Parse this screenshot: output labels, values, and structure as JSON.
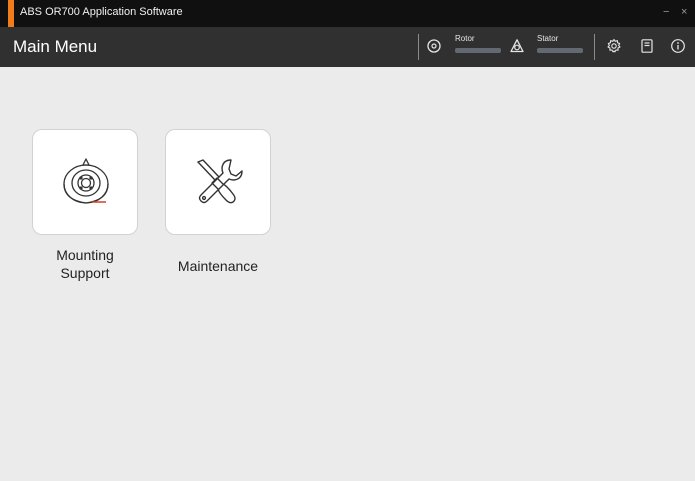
{
  "window": {
    "title": "ABS OR700 Application Software",
    "minimize_glyph": "−",
    "close_glyph": "×"
  },
  "header": {
    "page_title": "Main Menu",
    "rotor": {
      "label": "Rotor",
      "icon": "rotor-icon"
    },
    "stator": {
      "label": "Stator",
      "icon": "stator-icon"
    },
    "settings_icon": "gear-icon",
    "manual_icon": "document-icon",
    "info_icon": "info-icon"
  },
  "menu": {
    "items": [
      {
        "label_line1": "Mounting",
        "label_line2": "Support",
        "icon": "mounting-support-icon"
      },
      {
        "label_line1": "Maintenance",
        "label_line2": "",
        "icon": "wrench-screwdriver-icon"
      }
    ]
  },
  "colors": {
    "titlebar": "#101010",
    "header": "#303030",
    "accent": "#f07d1a",
    "background": "#ebebeb",
    "tile": "#ffffff"
  }
}
